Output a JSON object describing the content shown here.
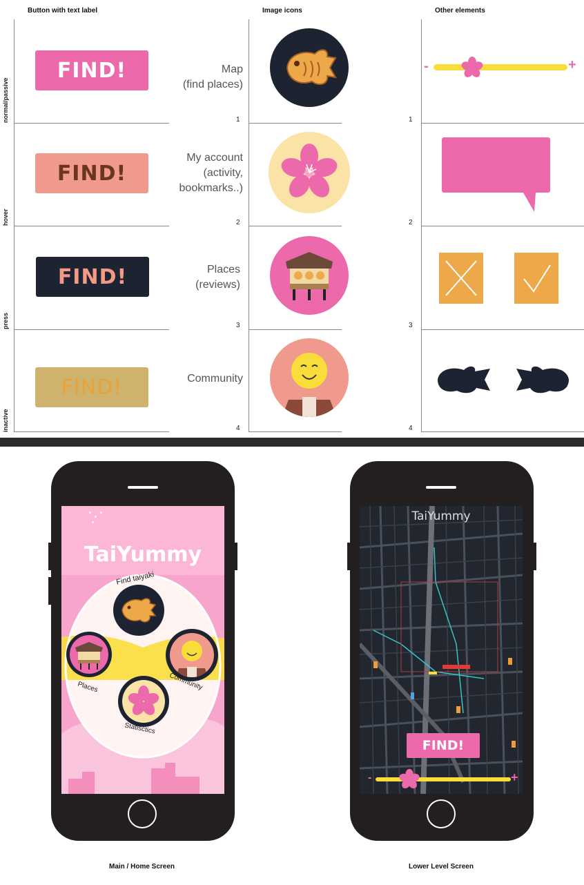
{
  "headers": {
    "buttons": "Button with text label",
    "icons": "Image icons",
    "other": "Other elements"
  },
  "row_labels": [
    "normal/passive",
    "hover",
    "press",
    "inactive"
  ],
  "row_numbers": [
    "1",
    "2",
    "3",
    "4"
  ],
  "buttons": [
    {
      "label": "FIND!",
      "bg": "#ec6aac",
      "fg": "#ffffff"
    },
    {
      "label": "FIND!",
      "bg": "#ef9a8d",
      "fg": "#6b3520"
    },
    {
      "label": "FIND!",
      "bg": "#1d2330",
      "fg": "#f39a86"
    },
    {
      "label": "FIND!",
      "bg": "#cfb36d",
      "fg": "#e8a23a"
    }
  ],
  "icon_labels": [
    [
      "Map",
      "(find places)"
    ],
    [
      "My account",
      "(activity,",
      "bookmarks..)"
    ],
    [
      "Places",
      "(reviews)"
    ],
    [
      "Community"
    ]
  ],
  "icons": [
    {
      "name": "taiyaki-icon",
      "bg": "#1d2330"
    },
    {
      "name": "sakura-icon",
      "bg": "#fbe3a7"
    },
    {
      "name": "food-stall-icon",
      "bg": "#ec6aac"
    },
    {
      "name": "community-face-icon",
      "bg": "#ef9a8d"
    }
  ],
  "slider": {
    "minus": "-",
    "plus": "+"
  },
  "phones": {
    "home": {
      "title": "TaiYummy",
      "menu": [
        "Find taiyaki",
        "Places",
        "Community",
        "Statisctics"
      ],
      "caption": "Main / Home Screen"
    },
    "map": {
      "title": "TaiYummy",
      "find": "FIND!",
      "minus": "-",
      "plus": "+",
      "caption": "Lower Level Screen"
    }
  },
  "colors": {
    "pink": "#ec6aac",
    "yellow": "#f9de3b",
    "orange": "#eda84a",
    "dark": "#1d2330"
  }
}
